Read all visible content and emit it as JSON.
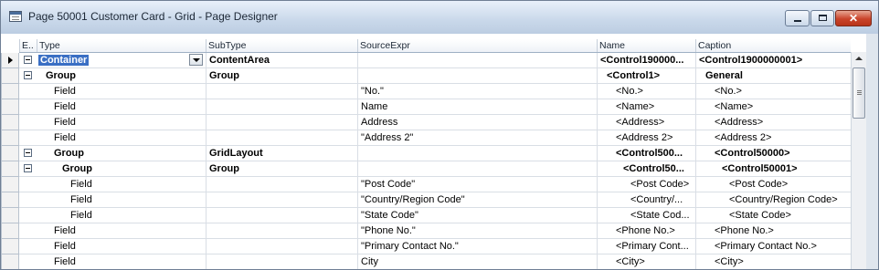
{
  "window": {
    "title": "Page 50001 Customer Card - Grid - Page Designer"
  },
  "columns": [
    "E..",
    "Type",
    "SubType",
    "SourceExpr",
    "Name",
    "Caption"
  ],
  "rows": [
    {
      "expander": true,
      "type": "Container",
      "subtype": "ContentArea",
      "source": "",
      "name": "<Control190000...",
      "caption": "<Control1900000001>",
      "bold": true,
      "indent": 0,
      "current": true
    },
    {
      "expander": true,
      "type": "Group",
      "subtype": "Group",
      "source": "",
      "name": "<Control1>",
      "caption": "General",
      "bold": true,
      "indent": 1
    },
    {
      "expander": false,
      "type": "Field",
      "subtype": "",
      "source": "\"No.\"",
      "name": "<No.>",
      "caption": "<No.>",
      "bold": false,
      "indent": 2
    },
    {
      "expander": false,
      "type": "Field",
      "subtype": "",
      "source": "Name",
      "name": "<Name>",
      "caption": "<Name>",
      "bold": false,
      "indent": 2
    },
    {
      "expander": false,
      "type": "Field",
      "subtype": "",
      "source": "Address",
      "name": "<Address>",
      "caption": "<Address>",
      "bold": false,
      "indent": 2
    },
    {
      "expander": false,
      "type": "Field",
      "subtype": "",
      "source": "\"Address 2\"",
      "name": "<Address 2>",
      "caption": "<Address 2>",
      "bold": false,
      "indent": 2
    },
    {
      "expander": true,
      "type": "Group",
      "subtype": "GridLayout",
      "source": "",
      "name": "<Control500...",
      "caption": "<Control50000>",
      "bold": true,
      "indent": 2
    },
    {
      "expander": true,
      "type": "Group",
      "subtype": "Group",
      "source": "",
      "name": "<Control50...",
      "caption": "<Control50001>",
      "bold": true,
      "indent": 3
    },
    {
      "expander": false,
      "type": "Field",
      "subtype": "",
      "source": "\"Post Code\"",
      "name": "<Post Code>",
      "caption": "<Post Code>",
      "bold": false,
      "indent": 4
    },
    {
      "expander": false,
      "type": "Field",
      "subtype": "",
      "source": "\"Country/Region Code\"",
      "name": "<Country/...",
      "caption": "<Country/Region Code>",
      "bold": false,
      "indent": 4
    },
    {
      "expander": false,
      "type": "Field",
      "subtype": "",
      "source": "\"State Code\"",
      "name": "<State Cod...",
      "caption": "<State Code>",
      "bold": false,
      "indent": 4
    },
    {
      "expander": false,
      "type": "Field",
      "subtype": "",
      "source": "\"Phone No.\"",
      "name": "<Phone No.>",
      "caption": "<Phone No.>",
      "bold": false,
      "indent": 2
    },
    {
      "expander": false,
      "type": "Field",
      "subtype": "",
      "source": "\"Primary Contact No.\"",
      "name": "<Primary Cont...",
      "caption": "<Primary Contact No.>",
      "bold": false,
      "indent": 2
    },
    {
      "expander": false,
      "type": "Field",
      "subtype": "",
      "source": "City",
      "name": "<City>",
      "caption": "<City>",
      "bold": false,
      "indent": 2
    }
  ]
}
